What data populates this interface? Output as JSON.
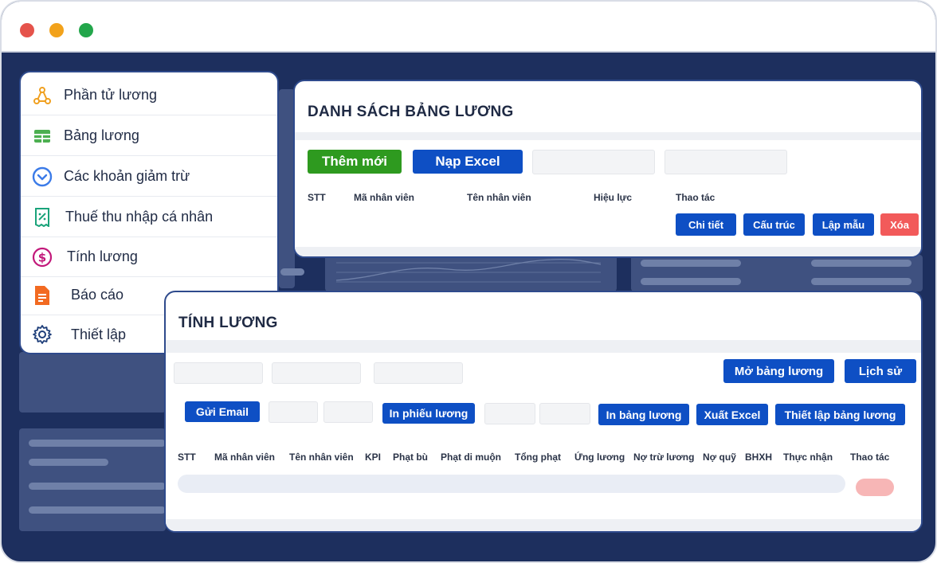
{
  "menu": {
    "items": [
      {
        "label": "Phần tử lương",
        "icon": "nodes-icon"
      },
      {
        "label": "Bảng lương",
        "icon": "table-icon"
      },
      {
        "label": "Các khoản giảm trừ",
        "icon": "chevron-circle-icon"
      },
      {
        "label": "Thuế thu nhập cá nhân",
        "icon": "receipt-percent-icon"
      },
      {
        "label": "Tính lương",
        "icon": "dollar-circle-icon"
      },
      {
        "label": "Báo cáo",
        "icon": "document-icon"
      },
      {
        "label": "Thiết lập",
        "icon": "gear-icon"
      }
    ]
  },
  "payroll_list": {
    "title": "DANH SÁCH BẢNG LƯƠNG",
    "add_label": "Thêm mới",
    "import_label": "Nạp Excel",
    "columns": [
      "STT",
      "Mã nhân viên",
      "Tên nhân viên",
      "Hiệu lực",
      "Thao tác"
    ],
    "actions": {
      "detail": "Chi tiết",
      "structure": "Cấu trúc",
      "template": "Lập mẫu",
      "delete": "Xóa"
    }
  },
  "salary_calc": {
    "title": "TÍNH LƯƠNG",
    "open_label": "Mở bảng lương",
    "history_label": "Lịch sử",
    "send_email_label": "Gửi Email",
    "print_slip_label": "In phiếu lương",
    "print_sheet_label": "In bảng lương",
    "export_label": "Xuất Excel",
    "setup_label": "Thiết lập bảng lương",
    "columns": [
      "STT",
      "Mã nhân viên",
      "Tên nhân viên",
      "KPI",
      "Phạt bù",
      "Phạt di muộn",
      "Tổng phạt",
      "Ứng lương",
      "Nợ trừ lương",
      "Nợ quỹ",
      "BHXH",
      "Thực nhận",
      "Thao tác"
    ]
  },
  "colors": {
    "frame": "#1d2f5e",
    "primary": "#0e4fc4",
    "success": "#2e9a1f",
    "danger": "#f25a5a"
  }
}
